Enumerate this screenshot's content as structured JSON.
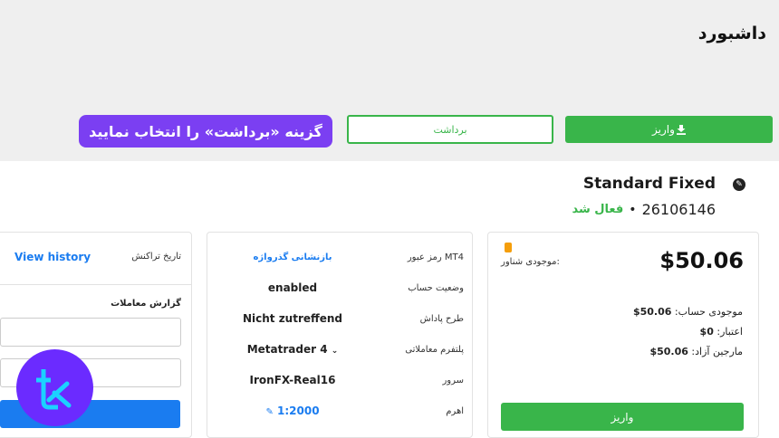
{
  "page": {
    "title": "داشبورد"
  },
  "actions": {
    "deposit_label": "واریز",
    "withdraw_label": "برداشت",
    "callout_text": "گزینه «برداشت» را انتخاب نمایید"
  },
  "account": {
    "name": "Standard Fixed",
    "number": "26106146",
    "status": "فعال شد"
  },
  "balance_card": {
    "float_label": "موجودی شناور:",
    "balance": "$50.06",
    "stats": [
      {
        "label": "موجودی حساب:",
        "value": "50.06$"
      },
      {
        "label": "اعتبار:",
        "value": "0$"
      },
      {
        "label": "مارجین آزاد:",
        "value": "50.06$"
      }
    ],
    "deposit_label": "واریز"
  },
  "info_card": {
    "rows": [
      {
        "label": "رمز عبور MT4",
        "value": "بازنشانی گذرواژه"
      },
      {
        "label": "وضعیت حساب",
        "value": "enabled"
      },
      {
        "label": "طرح پاداش",
        "value": "Nicht zutreffend"
      },
      {
        "label": "پلتفرم معاملاتی",
        "value": "Metatrader 4"
      },
      {
        "label": "سرور",
        "value": "IronFX-Real16"
      },
      {
        "label": "اهرم",
        "value": "1:2000"
      }
    ]
  },
  "history_card": {
    "title": "تاریخ تراکنش",
    "link": "View history",
    "report_title": "گزارش معاملات"
  },
  "colors": {
    "green": "#39b54a",
    "blue": "#1a7cf0",
    "purple": "#7b3ff2"
  }
}
